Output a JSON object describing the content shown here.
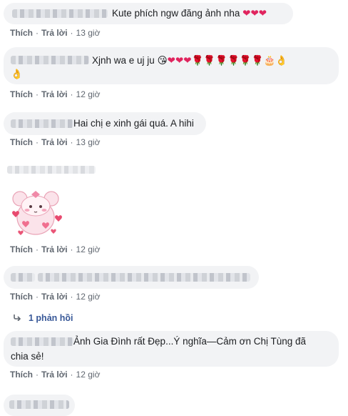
{
  "labels": {
    "like": "Thích",
    "reply": "Trả lời",
    "separator": "·"
  },
  "comments": [
    {
      "text": "Kute phích ngw đăng ảnh nha",
      "emoji": "❤❤❤",
      "time": "13 giờ"
    },
    {
      "text": "Xjnh wa e uj ju",
      "emoji_kiss": "😘",
      "emoji_hearts": "❤❤❤",
      "emoji_roses": "🌹🌹🌹🌹🌹🌹",
      "emoji_cake": "🎂",
      "emoji_hand": "👌",
      "time": "12 giờ"
    },
    {
      "text": "Hai chị e xinh gái quá. A hihi",
      "time": "13 giờ"
    },
    {
      "sticker": "pink-bear-hearts-sticker",
      "time": "12 giờ"
    },
    {
      "time": "12 giờ",
      "replies": "1 phản hồi"
    },
    {
      "line1": "Ảnh Gia Đình rất Đẹp...Ý nghĩa—Cảm ơn Chị Tùng đã",
      "line2": "chia sẻ!",
      "time": "12 giờ"
    }
  ],
  "colors": {
    "bubble": "#f2f3f5",
    "meta": "#606770",
    "link": "#385898",
    "heart": "#e0245e"
  }
}
